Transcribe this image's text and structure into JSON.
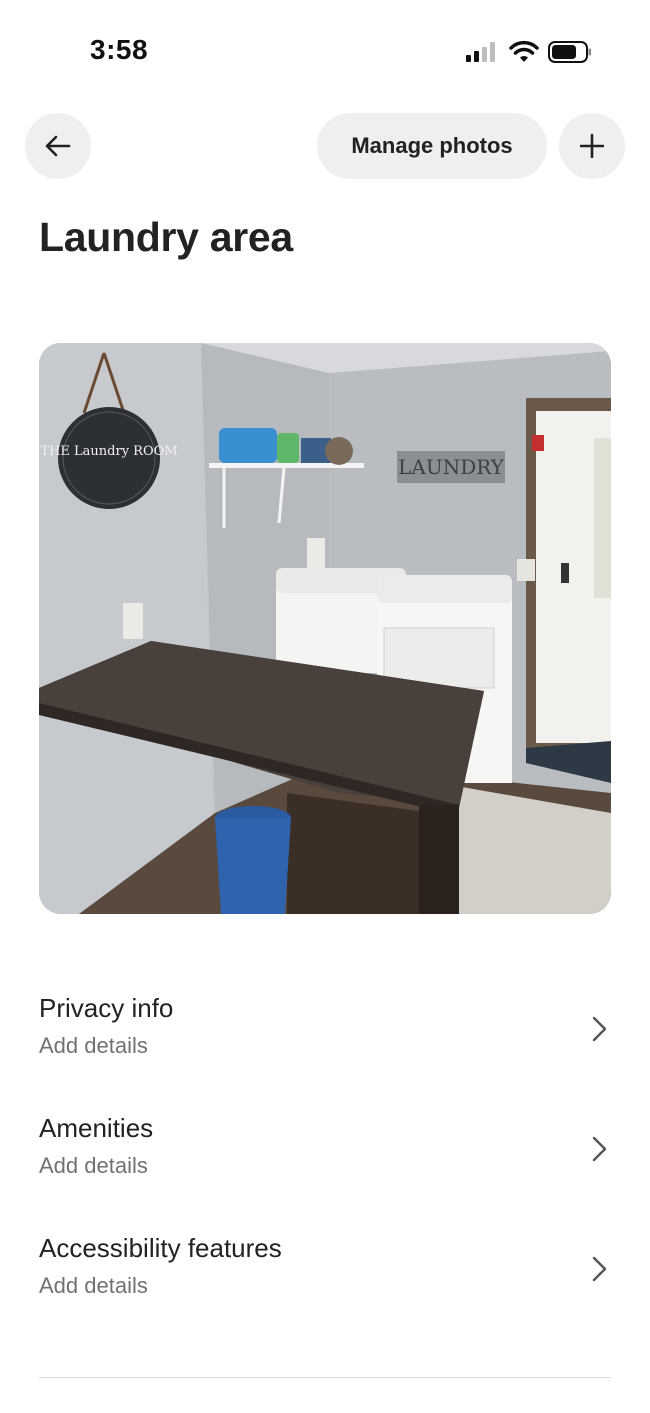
{
  "status_bar": {
    "time": "3:58"
  },
  "header": {
    "manage_photos_label": "Manage photos"
  },
  "page_title": "Laundry area",
  "photo": {
    "sign_text": "THE Laundry ROOM",
    "wall_letters": "LAUNDRY"
  },
  "details": [
    {
      "title": "Privacy info",
      "subtitle": "Add details"
    },
    {
      "title": "Amenities",
      "subtitle": "Add details"
    },
    {
      "title": "Accessibility features",
      "subtitle": "Add details"
    }
  ],
  "icons": {
    "back": "arrow-left-icon",
    "add": "plus-icon",
    "chevron": "chevron-right-icon"
  }
}
